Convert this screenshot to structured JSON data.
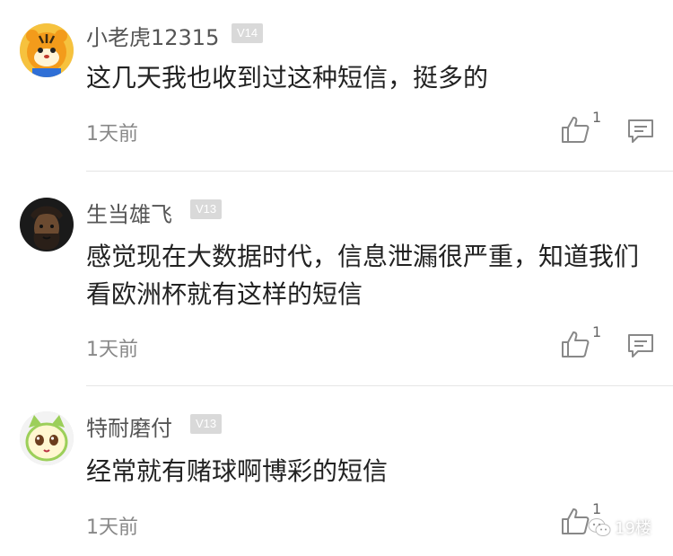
{
  "comments": [
    {
      "username": "小老虎12315",
      "level": "V14",
      "content": "这几天我也收到过这种短信，挺多的",
      "time": "1天前",
      "likes": "1",
      "avatar": "tiger-avatar"
    },
    {
      "username": "生当雄飞",
      "level": "V13",
      "content": "感觉现在大数据时代，信息泄漏很严重，知道我们看欧洲杯就有这样的短信",
      "time": "1天前",
      "likes": "1",
      "avatar": "pirate-avatar"
    },
    {
      "username": "特耐磨付",
      "level": "V13",
      "content": "经常就有赌球啊博彩的短信",
      "time": "1天前",
      "likes": "1",
      "avatar": "cartoon-cat-avatar"
    }
  ],
  "watermark": {
    "text": "19楼",
    "icon": "wechat-icon"
  },
  "colors": {
    "badge": "#d9d9d9",
    "divider": "#e5e5e5",
    "meta": "#888888"
  }
}
